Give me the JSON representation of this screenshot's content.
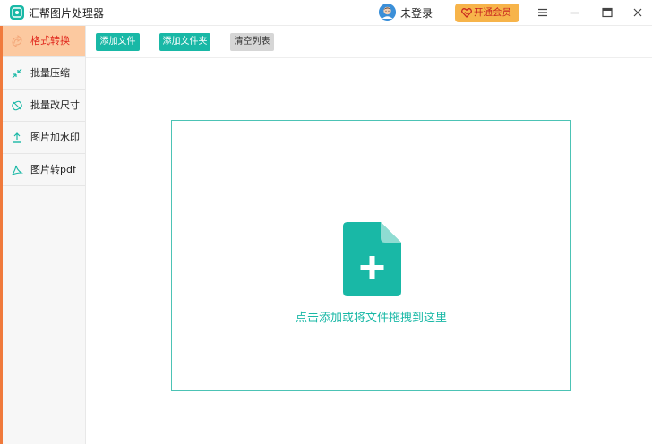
{
  "app": {
    "title": "汇帮图片处理器",
    "login_text": "未登录",
    "vip_label": "开通会员"
  },
  "window_controls": [
    "menu-icon",
    "minimize-icon",
    "maximize-icon",
    "close-icon"
  ],
  "sidebar": {
    "items": [
      {
        "label": "格式转换",
        "icon": "format-convert-icon",
        "active": true
      },
      {
        "label": "批量压缩",
        "icon": "compress-icon",
        "active": false
      },
      {
        "label": "批量改尺寸",
        "icon": "resize-icon",
        "active": false
      },
      {
        "label": "图片加水印",
        "icon": "watermark-icon",
        "active": false
      },
      {
        "label": "图片转pdf",
        "icon": "pdf-icon",
        "active": false
      }
    ]
  },
  "toolbar": {
    "add_file": "添加文件",
    "add_folder": "添加文件夹",
    "clear_list": "清空列表"
  },
  "dropzone": {
    "hint": "点击添加或将文件拖拽到这里",
    "icon": "file-add-icon"
  },
  "colors": {
    "accent": "#19b8a6",
    "sidebar_active": "#fcc9a0",
    "sidebar_stripe": "#f07a3c",
    "active_text": "#e0261c",
    "vip": "#f7b44a"
  }
}
